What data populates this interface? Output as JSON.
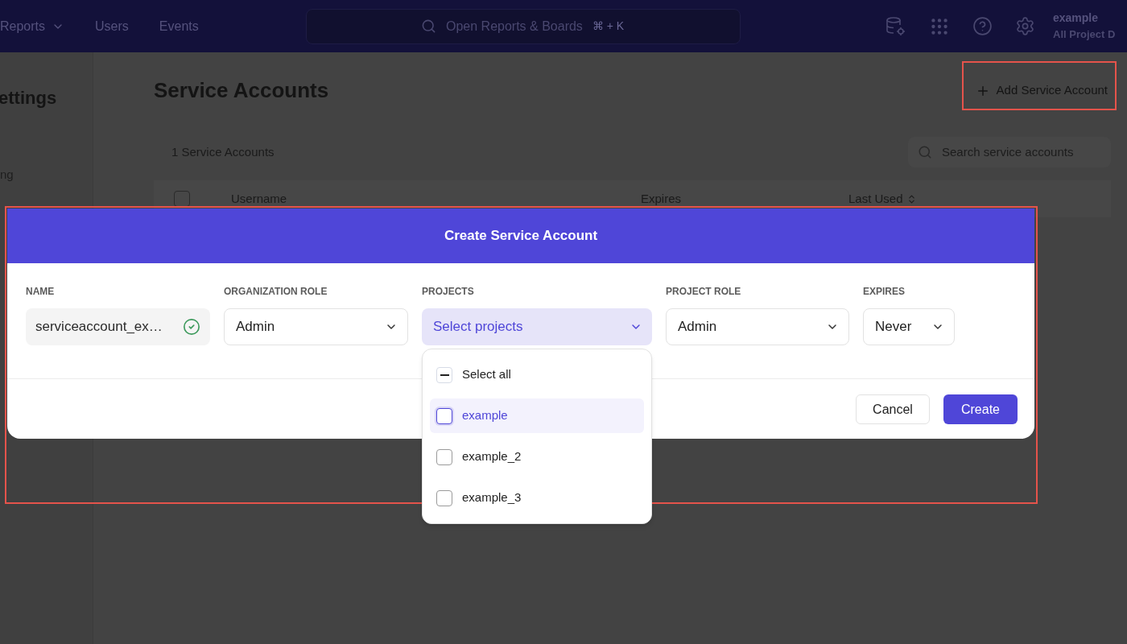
{
  "top_nav": {
    "items": [
      {
        "label": "Reports",
        "has_menu": true
      },
      {
        "label": "Users",
        "has_menu": false
      },
      {
        "label": "Events",
        "has_menu": false
      }
    ],
    "search": {
      "placeholder": "Open Reports & Boards",
      "shortcut": "⌘ + K"
    },
    "user": {
      "name": "example",
      "project": "All Project D"
    }
  },
  "sidebar": {
    "title": "ettings",
    "items": [
      "ng"
    ]
  },
  "page": {
    "title": "Service Accounts",
    "add_button": {
      "label": "Add Service Account",
      "highlighted": true
    },
    "count": "1 Service Accounts",
    "search": {
      "placeholder": "Search service accounts"
    },
    "table": {
      "select_all_checked": false,
      "columns": [
        {
          "label": "Username",
          "sortable": false
        },
        {
          "label": "Expires",
          "sortable": false
        },
        {
          "label": "Last Used",
          "sortable": true
        }
      ]
    }
  },
  "dialog": {
    "title": "Create Service Account",
    "highlighted": true,
    "fields": [
      {
        "label": "NAME",
        "kind": "text",
        "value": "serviceaccount_ex…",
        "valid": true
      },
      {
        "label": "ORGANIZATION ROLE",
        "kind": "select",
        "value": "Admin"
      },
      {
        "label": "PROJECTS",
        "kind": "multiselect",
        "placeholder": "Select projects",
        "open": true,
        "options": [
          {
            "label": "Select all",
            "kind": "select_all",
            "indeterminate": true,
            "highlighted": false
          },
          {
            "label": "example",
            "kind": "option",
            "checked": false,
            "highlighted": true
          },
          {
            "label": "example_2",
            "kind": "option",
            "checked": false,
            "highlighted": false
          },
          {
            "label": "example_3",
            "kind": "option",
            "checked": false,
            "highlighted": false
          }
        ]
      },
      {
        "label": "PROJECT ROLE",
        "kind": "select",
        "value": "Admin"
      },
      {
        "label": "EXPIRES",
        "kind": "select",
        "value": "Never"
      }
    ],
    "buttons": [
      {
        "label": "Cancel",
        "kind": "secondary"
      },
      {
        "label": "Create",
        "kind": "primary"
      }
    ]
  }
}
